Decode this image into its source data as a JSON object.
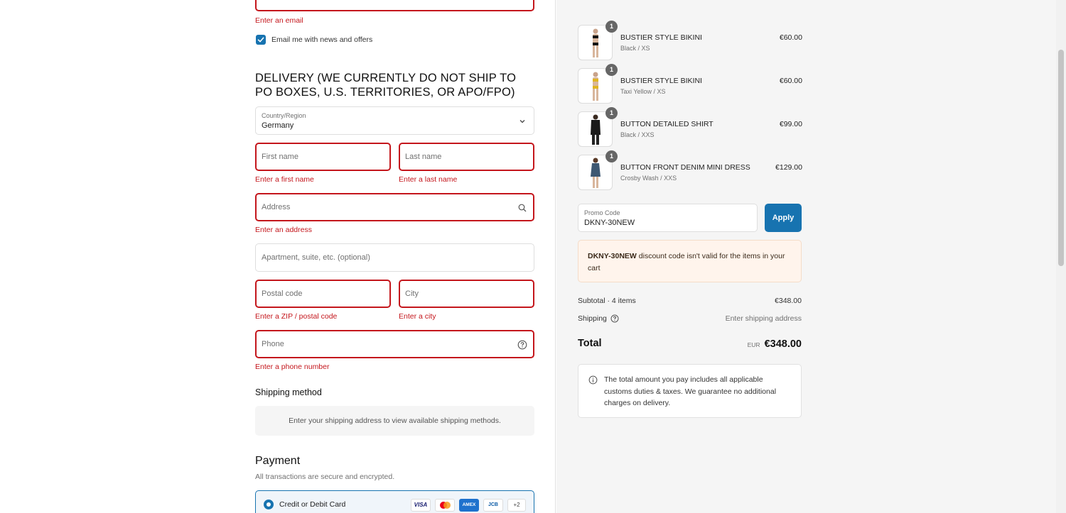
{
  "contact": {
    "email_error": "Enter an email",
    "newsletter_label": "Email me with news and offers"
  },
  "delivery": {
    "title": "DELIVERY (WE CURRENTLY DO NOT SHIP TO PO BOXES, U.S. TERRITORIES, OR APO/FPO)",
    "country_label": "Country/Region",
    "country_value": "Germany",
    "first_name_ph": "First name",
    "last_name_ph": "Last name",
    "first_name_err": "Enter a first name",
    "last_name_err": "Enter a last name",
    "address_ph": "Address",
    "address_err": "Enter an address",
    "apartment_ph": "Apartment, suite, etc. (optional)",
    "postal_ph": "Postal code",
    "city_ph": "City",
    "postal_err": "Enter a ZIP / postal code",
    "city_err": "Enter a city",
    "phone_ph": "Phone",
    "phone_err": "Enter a phone number"
  },
  "shipping_method": {
    "title": "Shipping method",
    "message": "Enter your shipping address to view available shipping methods."
  },
  "payment": {
    "title": "Payment",
    "subtitle": "All transactions are secure and encrypted.",
    "option_label": "Credit or Debit Card",
    "cards": [
      "VISA",
      "MC",
      "AMEX",
      "JCB"
    ],
    "more_cards": "+2"
  },
  "cart": {
    "items": [
      {
        "name": "BUSTIER STYLE BIKINI",
        "variant": "Black / XS",
        "price": "€60.00",
        "qty": "1"
      },
      {
        "name": "BUSTIER STYLE BIKINI",
        "variant": "Taxi Yellow / XS",
        "price": "€60.00",
        "qty": "1"
      },
      {
        "name": "BUTTON DETAILED SHIRT",
        "variant": "Black / XXS",
        "price": "€99.00",
        "qty": "1"
      },
      {
        "name": "BUTTON FRONT DENIM MINI DRESS",
        "variant": "Crosby Wash / XXS",
        "price": "€129.00",
        "qty": "1"
      }
    ],
    "promo_label": "Promo Code",
    "promo_value": "DKNY-30NEW",
    "apply_label": "Apply",
    "promo_error_code": "DKNY-30NEW",
    "promo_error_text": " discount code isn't valid for the items in your cart",
    "subtotal_label": "Subtotal · 4 items",
    "subtotal_value": "€348.00",
    "shipping_label": "Shipping",
    "shipping_value": "Enter shipping address",
    "total_label": "Total",
    "total_currency": "EUR",
    "total_value": "€348.00",
    "notice": "The total amount you pay includes all applicable customs duties & taxes. We guarantee no additional charges on delivery."
  },
  "colors": {
    "accent": "#1773b0",
    "error": "#c4161c",
    "sidebar_bg": "#f5f5f5",
    "promo_error_bg": "#fff4ec"
  }
}
